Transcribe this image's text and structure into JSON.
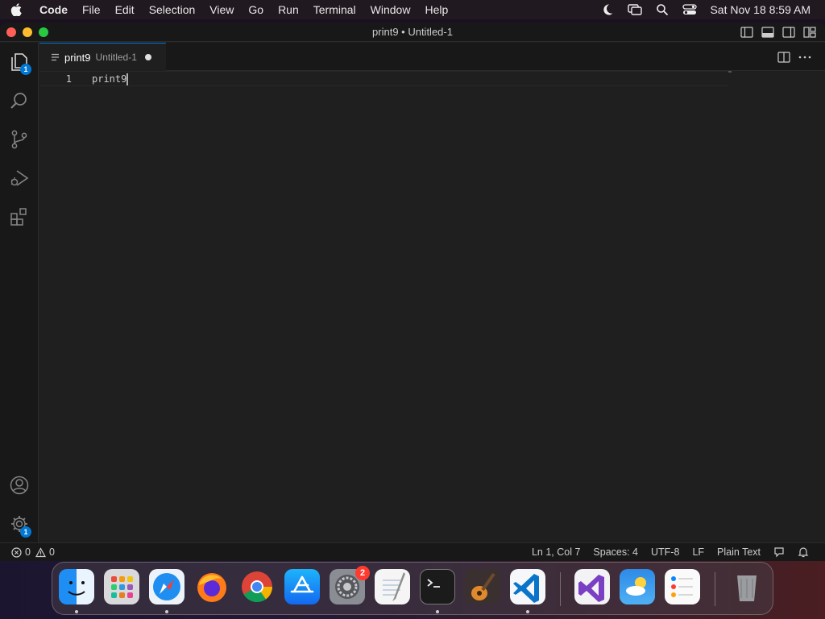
{
  "menubar": {
    "app_name": "Code",
    "items": [
      "File",
      "Edit",
      "Selection",
      "View",
      "Go",
      "Run",
      "Terminal",
      "Window",
      "Help"
    ],
    "clock": "Sat Nov 18  8:59 AM",
    "icons": [
      "moon-icon",
      "screen-mirroring-icon",
      "spotlight-search-icon",
      "control-center-icon"
    ]
  },
  "window": {
    "title": "print9 • Untitled-1"
  },
  "activity_bar": {
    "explorer_badge": "1",
    "settings_badge": "1"
  },
  "tab": {
    "label": "print9",
    "description": "Untitled-1",
    "dirty": true
  },
  "editor": {
    "line_number": "1",
    "code": "print9"
  },
  "statusbar": {
    "errors": "0",
    "warnings": "0",
    "position": "Ln 1, Col 7",
    "indent": "Spaces: 4",
    "encoding": "UTF-8",
    "eol": "LF",
    "language": "Plain Text"
  },
  "dock": {
    "apps": [
      "Finder",
      "Launchpad",
      "Safari",
      "Firefox",
      "Google Chrome",
      "App Store",
      "System Settings",
      "TextEdit",
      "Terminal",
      "GarageBand",
      "Visual Studio Code",
      "Visual Studio",
      "Weather",
      "Reminders",
      "Trash"
    ],
    "settings_badge": "2"
  },
  "colors": {
    "accent": "#0078d4",
    "editor_bg": "#1f1f1f",
    "chrome_bg": "#181818"
  }
}
